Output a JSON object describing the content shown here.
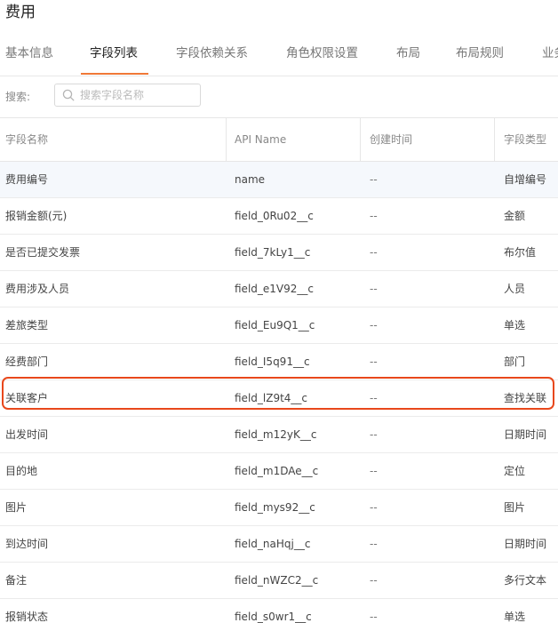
{
  "header": {
    "title": "费用"
  },
  "tabs": [
    {
      "label": "基本信息"
    },
    {
      "label": "字段列表"
    },
    {
      "label": "字段依赖关系"
    },
    {
      "label": "角色权限设置"
    },
    {
      "label": "布局"
    },
    {
      "label": "布局规则"
    },
    {
      "label": "业务"
    }
  ],
  "active_tab": "字段列表",
  "accent_color": "#f07837",
  "highlight_color": "#e8481c",
  "search": {
    "label": "搜索:",
    "placeholder": "搜索字段名称",
    "icon": "search-icon"
  },
  "table": {
    "columns": [
      "字段名称",
      "API Name",
      "创建时间",
      "字段类型"
    ],
    "rows": [
      {
        "name": "费用编号",
        "api": "name",
        "created": "--",
        "type": "自增编号"
      },
      {
        "name": "报销金额(元)",
        "api": "field_0Ru02__c",
        "created": "--",
        "type": "金额"
      },
      {
        "name": "是否已提交发票",
        "api": "field_7kLy1__c",
        "created": "--",
        "type": "布尔值"
      },
      {
        "name": "费用涉及人员",
        "api": "field_e1V92__c",
        "created": "--",
        "type": "人员"
      },
      {
        "name": "差旅类型",
        "api": "field_Eu9Q1__c",
        "created": "--",
        "type": "单选"
      },
      {
        "name": "经费部门",
        "api": "field_I5q91__c",
        "created": "--",
        "type": "部门"
      },
      {
        "name": "关联客户",
        "api": "field_lZ9t4__c",
        "created": "--",
        "type": "查找关联"
      },
      {
        "name": "出发时间",
        "api": "field_m12yK__c",
        "created": "--",
        "type": "日期时间"
      },
      {
        "name": "目的地",
        "api": "field_m1DAe__c",
        "created": "--",
        "type": "定位"
      },
      {
        "name": "图片",
        "api": "field_mys92__c",
        "created": "--",
        "type": "图片"
      },
      {
        "name": "到达时间",
        "api": "field_naHqj__c",
        "created": "--",
        "type": "日期时间"
      },
      {
        "name": "备注",
        "api": "field_nWZC2__c",
        "created": "--",
        "type": "多行文本"
      },
      {
        "name": "报销状态",
        "api": "field_s0wr1__c",
        "created": "--",
        "type": "单选"
      }
    ]
  }
}
